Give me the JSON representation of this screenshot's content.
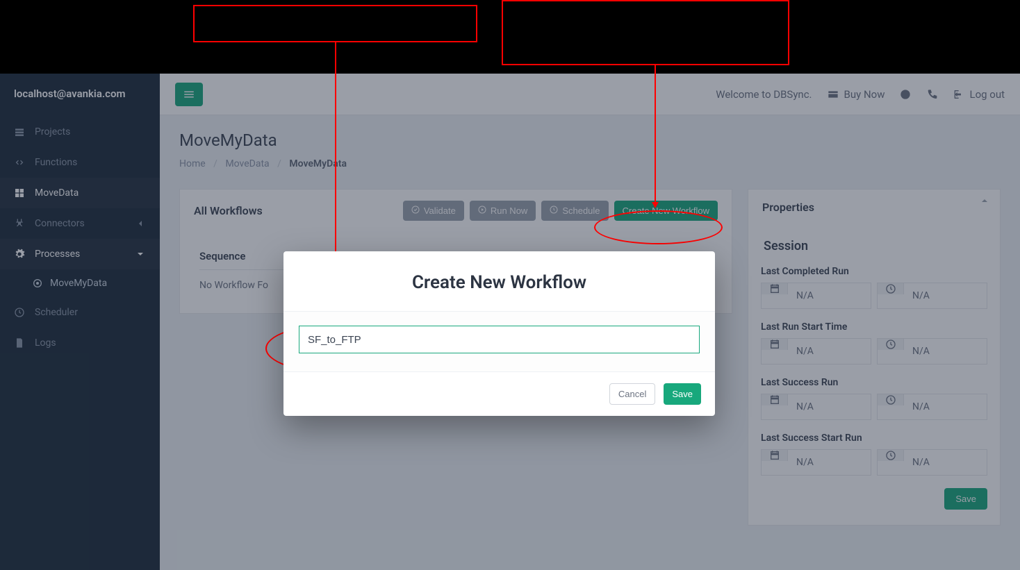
{
  "sidebar": {
    "brand": "localhost@avankia.com",
    "items": [
      {
        "label": "Projects"
      },
      {
        "label": "Functions"
      },
      {
        "label": "MoveData"
      },
      {
        "label": "Connectors"
      },
      {
        "label": "Processes"
      },
      {
        "label": "Scheduler"
      },
      {
        "label": "Logs"
      }
    ],
    "sub": {
      "processes": [
        {
          "label": "MoveMyData"
        }
      ]
    }
  },
  "topbar": {
    "welcome": "Welcome to DBSync.",
    "buy_now": "Buy Now",
    "log_out": "Log out"
  },
  "page": {
    "title": "MoveMyData",
    "breadcrumbs": [
      "Home",
      "MoveData",
      "MoveMyData"
    ]
  },
  "workflows": {
    "title": "All Workflows",
    "validate": "Validate",
    "run_now": "Run Now",
    "schedule": "Schedule",
    "create": "Create New Workflow",
    "col_sequence": "Sequence",
    "empty": "No Workflow Fo"
  },
  "properties": {
    "title": "Properties",
    "session": "Session",
    "groups": [
      {
        "label": "Last Completed Run",
        "date": "N/A",
        "time": "N/A"
      },
      {
        "label": "Last Run Start Time",
        "date": "N/A",
        "time": "N/A"
      },
      {
        "label": "Last Success Run",
        "date": "N/A",
        "time": "N/A"
      },
      {
        "label": "Last Success Start Run",
        "date": "N/A",
        "time": "N/A"
      }
    ],
    "save": "Save"
  },
  "modal": {
    "title": "Create New Workflow",
    "input_value": "SF_to_FTP",
    "cancel": "Cancel",
    "save": "Save"
  }
}
